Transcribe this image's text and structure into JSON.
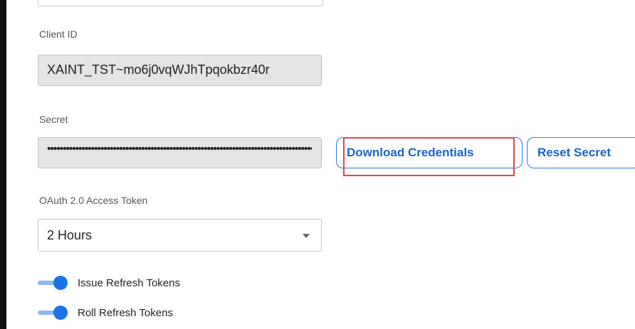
{
  "client_id": {
    "label": "Client ID",
    "value": "XAINT_TST~mo6j0vqWJhTpqokbzr40r"
  },
  "secret": {
    "label": "Secret",
    "masked_value": "••••••••••••••••••••••••••••••••••••••••••••••••••••••••••••••••••••••••••••••••••••••••"
  },
  "buttons": {
    "download_credentials": "Download Credentials",
    "reset_secret": "Reset Secret"
  },
  "access_token": {
    "label": "OAuth 2.0 Access Token",
    "selected": "2 Hours"
  },
  "toggles": [
    {
      "label": "Issue Refresh Tokens",
      "on": true
    },
    {
      "label": "Roll Refresh Tokens",
      "on": true
    }
  ],
  "colors": {
    "accent": "#1a73e8",
    "highlight": "#e0454b"
  }
}
